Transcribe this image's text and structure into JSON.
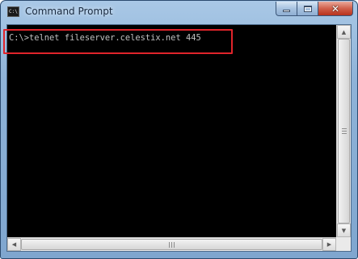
{
  "window": {
    "title": "Command Prompt",
    "icon_text": "C:\\"
  },
  "console": {
    "command": "C:\\>telnet fileserver.celestix.net 445"
  },
  "colors": {
    "highlight": "#e0242b",
    "console_background": "#000000",
    "console_text": "#c0c0c0"
  },
  "icons": {
    "app": "command-prompt-icon",
    "minimize": "minimize-icon",
    "maximize": "maximize-icon",
    "close": "close-icon",
    "scroll_up": "arrow-up-icon",
    "scroll_down": "arrow-down-icon",
    "scroll_left": "arrow-left-icon",
    "scroll_right": "arrow-right-icon"
  }
}
